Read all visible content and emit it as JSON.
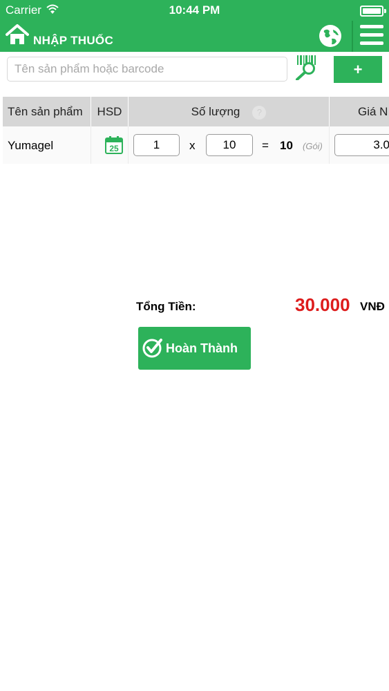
{
  "status_bar": {
    "carrier": "Carrier",
    "time": "10:44 PM"
  },
  "header": {
    "title": "NHẬP THUỐC"
  },
  "search": {
    "placeholder": "Tên sản phẩm hoặc barcode",
    "add_label": "+"
  },
  "table": {
    "headers": {
      "product": "Tên sản phẩm",
      "expiry": "HSD",
      "quantity": "Số lượng",
      "quantity_help": "?",
      "price": "Giá N"
    },
    "rows": [
      {
        "product": "Yumagel",
        "expiry_icon_day": "25",
        "qty_packs": "1",
        "times": "x",
        "qty_per_pack": "10",
        "equals": "=",
        "qty_total": "10",
        "unit": "(Gói)",
        "price": "3.0"
      }
    ]
  },
  "total": {
    "label": "Tổng Tiền:",
    "value": "30.000",
    "currency": "VNĐ"
  },
  "done_button": {
    "label": "Hoàn Thành"
  },
  "colors": {
    "primary_green": "#2db25a",
    "total_red": "#dd1c1c",
    "header_gray": "#d6d6d6"
  }
}
